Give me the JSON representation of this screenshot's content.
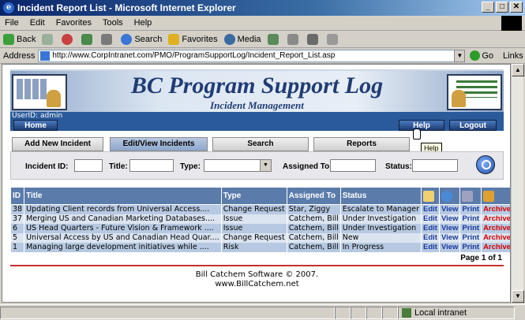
{
  "window": {
    "title": "Incident Report List - Microsoft Internet Explorer",
    "controls": [
      "_",
      "□",
      "✕"
    ]
  },
  "menu": [
    "File",
    "Edit",
    "Favorites",
    "Tools",
    "Help"
  ],
  "toolbar": {
    "back": "Back",
    "search": "Search",
    "favorites": "Favorites",
    "media": "Media"
  },
  "address": {
    "label": "Address",
    "url": "http://www.CorpIntranet.com/PMO/ProgramSupportLog/Incident_Report_List.asp",
    "go": "Go",
    "links": "Links"
  },
  "header": {
    "title": "BC Program Support Log",
    "subtitle": "Incident Management",
    "userid": "UserID: admin",
    "home": "Home",
    "help": "Help",
    "logout": "Logout"
  },
  "tabs": [
    "Add New Incident",
    "Edit/View Incidents",
    "Search",
    "Reports"
  ],
  "tooltip": "Help",
  "search": {
    "incident_id": "Incident ID:",
    "title": "Title:",
    "type": "Type:",
    "assigned_to": "Assigned To:",
    "status": "Status:"
  },
  "table": {
    "headers": [
      "ID",
      "Title",
      "Type",
      "Assigned To",
      "Status"
    ],
    "action_labels": {
      "edit": "Edit",
      "view": "View",
      "print": "Print",
      "archive": "Archive"
    },
    "rows": [
      {
        "id": "38",
        "title": "Updating Client records from Universal Access....",
        "type": "Change Request",
        "assigned": "Star, Ziggy",
        "status": "Escalate to Manager"
      },
      {
        "id": "37",
        "title": "Merging US and Canadian Marketing Databases....",
        "type": "Issue",
        "assigned": "Catchem, Bill",
        "status": "Under Investigation"
      },
      {
        "id": "6",
        "title": "US Head Quarters - Future Vision & Framework ....",
        "type": "Issue",
        "assigned": "Catchem, Bill",
        "status": "Under Investigation"
      },
      {
        "id": "5",
        "title": "Universal Access by US and Canadian Head Quar....",
        "type": "Change Request",
        "assigned": "Catchem, Bill",
        "status": "New"
      },
      {
        "id": "1",
        "title": "Managing large development initiatives while ....",
        "type": "Risk",
        "assigned": "Catchem, Bill",
        "status": "In Progress"
      }
    ],
    "page_info": "Page 1 of 1"
  },
  "footer": {
    "line1": "Bill Catchem Software © 2007.",
    "line2": "www.BillCatchem.net"
  },
  "status": {
    "zone": "Local intranet"
  }
}
